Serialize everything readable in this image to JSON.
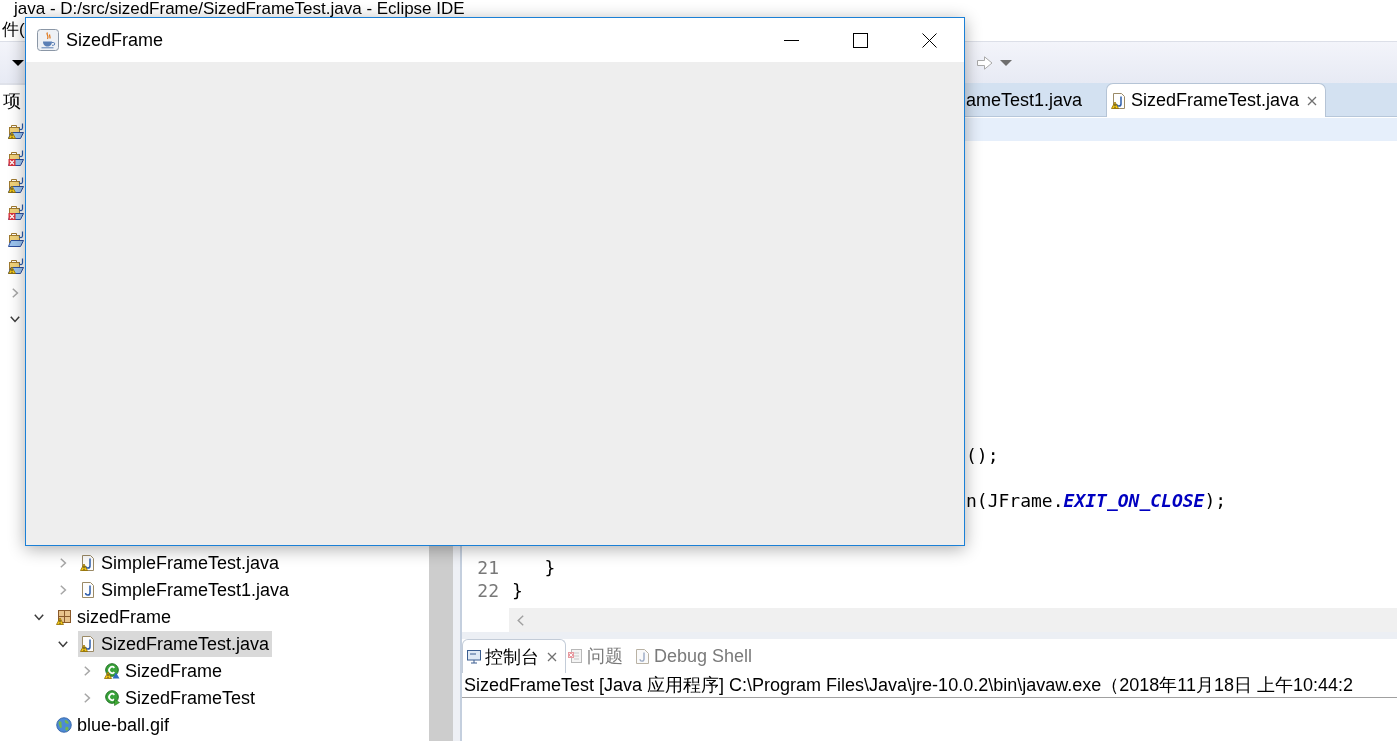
{
  "ide": {
    "title": "java - D:/src/sizedFrame/SizedFrameTest.java - Eclipse IDE",
    "menu": [
      "件("
    ],
    "toolbar": {
      "left": [
        {
          "kind": "dropdown",
          "disabled": false
        }
      ],
      "right": [
        {
          "kind": "forward",
          "disabled": true
        },
        {
          "kind": "dropdown",
          "disabled": true
        }
      ]
    },
    "explorer": {
      "tab": "项",
      "tree": [
        {
          "kind": "project",
          "warning": true,
          "error": false,
          "selected": false
        },
        {
          "kind": "project",
          "warning": false,
          "error": true,
          "selected": false
        },
        {
          "kind": "project",
          "warning": true,
          "error": false,
          "selected": false
        },
        {
          "kind": "project",
          "warning": false,
          "error": true,
          "selected": false
        },
        {
          "kind": "project",
          "warning": false,
          "error": false,
          "selected": false
        },
        {
          "kind": "project",
          "warning": true,
          "error": false,
          "selected": false,
          "children": [
            {
              "expanded": false
            },
            {
              "expanded": true,
              "children": [
                {
                  "children": [
                    {
                      "kind": "java-file",
                      "label": "SimpleFrameTest.java",
                      "warning": true,
                      "error": false,
                      "expanded": false,
                      "selected": false
                    },
                    {
                      "kind": "java-file",
                      "label": "SimpleFrameTest1.java",
                      "warning": false,
                      "error": false,
                      "expanded": false,
                      "selected": false
                    }
                  ]
                },
                {
                  "kind": "package",
                  "label": "sizedFrame",
                  "warning": true,
                  "error": false,
                  "expanded": true,
                  "selected": false,
                  "children": [
                    {
                      "kind": "java-file",
                      "label": "SizedFrameTest.java",
                      "warning": true,
                      "error": false,
                      "expanded": true,
                      "selected": true,
                      "children": [
                        {
                          "kind": "package-class",
                          "label": "SizedFrame",
                          "warning": true,
                          "error": false,
                          "expanded": false,
                          "selected": false
                        },
                        {
                          "kind": "main-class",
                          "label": "SizedFrameTest",
                          "warning": false,
                          "error": false,
                          "expanded": false,
                          "selected": false
                        }
                      ]
                    }
                  ]
                },
                {
                  "kind": "image-file",
                  "label": "blue-ball.gif",
                  "warning": false,
                  "error": false,
                  "selected": false
                }
              ]
            }
          ]
        }
      ]
    },
    "editor": {
      "tabs": [
        {
          "label": "ameTest1.java",
          "selected": false
        },
        {
          "kind": "java-file",
          "warning": true,
          "error": false,
          "label": "SizedFrameTest.java",
          "selected": true,
          "closable": true
        }
      ],
      "highlight_current_line": true,
      "lines": [
        {
          "covered": true,
          "segments": [
            {
              "text": "();"
            }
          ]
        },
        {
          "covered": true,
          "segments": [
            {
              "text": "n(JFrame."
            },
            {
              "kind": "constant",
              "text": "EXIT_ON_CLOSE"
            },
            {
              "text": ");"
            }
          ]
        },
        {
          "number": "21",
          "segments": [
            {
              "text": "   }"
            }
          ]
        },
        {
          "number": "22",
          "segments": [
            {
              "text": "}"
            }
          ]
        }
      ]
    },
    "console": {
      "tabs": [
        {
          "kind": "console",
          "label": "控制台",
          "selected": true,
          "closable": true
        },
        {
          "kind": "problems",
          "label": "问题",
          "selected": false
        },
        {
          "kind": "debug-shell",
          "label": "Debug Shell",
          "selected": false
        }
      ],
      "output": "SizedFrameTest [Java 应用程序] C:\\Program Files\\Java\\jre-10.0.2\\bin\\javaw.exe（2018年11月18日 上午10:44:2"
    }
  },
  "frame": {
    "title": "SizedFrame"
  }
}
